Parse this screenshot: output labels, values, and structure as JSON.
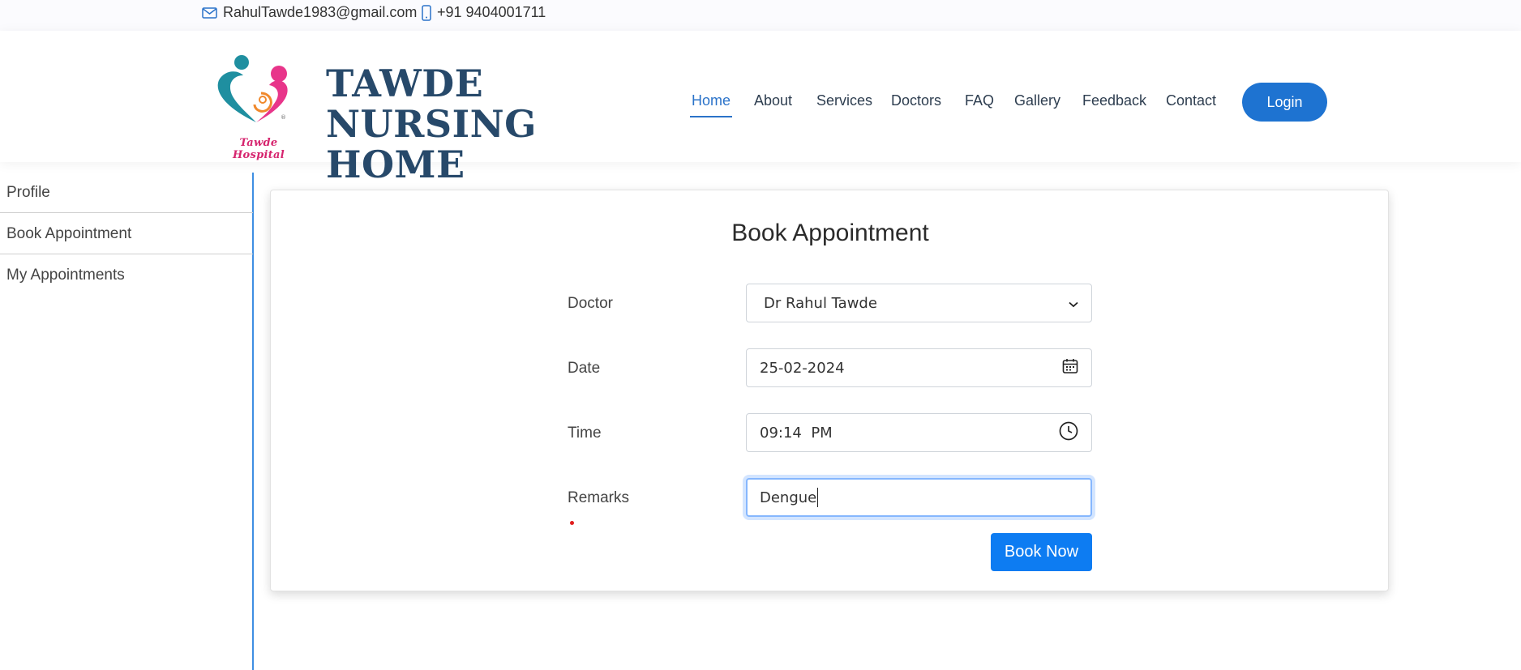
{
  "topbar": {
    "email": "RahulTawde1983@gmail.com",
    "email_icon": "envelope-icon",
    "phone": "+91 9404001711",
    "phone_icon": "mobile-phone-icon"
  },
  "header": {
    "logo_caption": "Tawde Hospital",
    "brand_line1": "TAWDE NURSING",
    "brand_line2": "HOME",
    "nav": [
      "Home",
      "About",
      "Services",
      "Doctors",
      "FAQ",
      "Gallery",
      "Feedback",
      "Contact"
    ],
    "active_nav": "Home",
    "login_label": "Login"
  },
  "sidebar": {
    "items": [
      {
        "label": "Profile"
      },
      {
        "label": "Book Appointment"
      },
      {
        "label": "My Appointments"
      }
    ]
  },
  "form": {
    "title": "Book Appointment",
    "doctor_label": "Doctor",
    "doctor_value": "Dr Rahul Tawde",
    "date_label": "Date",
    "date_value": "25-02-2024",
    "time_label": "Time",
    "time_value": "09:14  PM",
    "remarks_label": "Remarks",
    "remarks_value": "Dengue",
    "submit_label": "Book Now"
  },
  "colors": {
    "accent": "#1e73d1",
    "brand": "#27496a",
    "button": "#0d7cf2",
    "logo_pink": "#d6246e",
    "logo_teal": "#1f8fa0"
  }
}
